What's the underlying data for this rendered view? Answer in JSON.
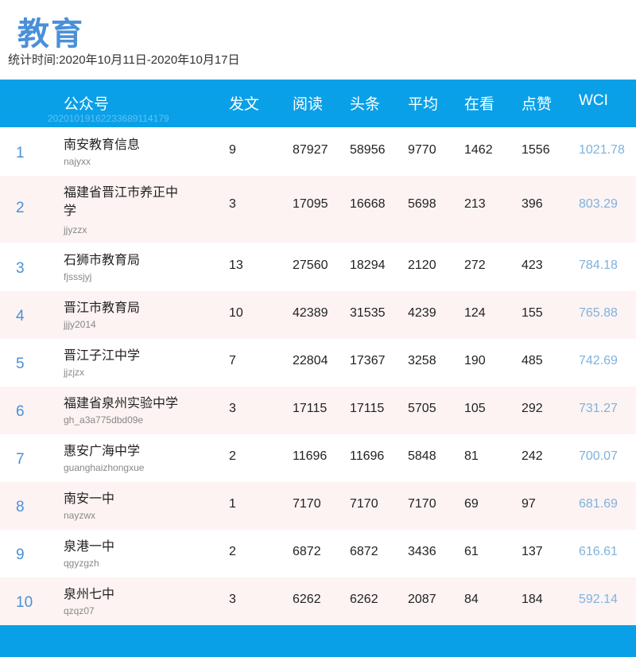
{
  "title": "教育",
  "period": "统计时间:2020年10月11日-2020年10月17日",
  "header": {
    "account": "公众号",
    "code": "20201019162233689114179",
    "posts": "发文",
    "reads": "阅读",
    "headline": "头条",
    "avg": "平均",
    "watching": "在看",
    "likes": "点赞",
    "wci": "WCI"
  },
  "rows": [
    {
      "rank": "1",
      "name": "南安教育信息",
      "acct": "najyxx",
      "posts": "9",
      "reads": "87927",
      "headline": "58956",
      "avg": "9770",
      "watching": "1462",
      "likes": "1556",
      "wci": "1021.78"
    },
    {
      "rank": "2",
      "name": "福建省晋江市养正中学",
      "acct": "jjyzzx",
      "posts": "3",
      "reads": "17095",
      "headline": "16668",
      "avg": "5698",
      "watching": "213",
      "likes": "396",
      "wci": "803.29"
    },
    {
      "rank": "3",
      "name": "石狮市教育局",
      "acct": "fjsssjyj",
      "posts": "13",
      "reads": "27560",
      "headline": "18294",
      "avg": "2120",
      "watching": "272",
      "likes": "423",
      "wci": "784.18"
    },
    {
      "rank": "4",
      "name": "晋江市教育局",
      "acct": "jjjy2014",
      "posts": "10",
      "reads": "42389",
      "headline": "31535",
      "avg": "4239",
      "watching": "124",
      "likes": "155",
      "wci": "765.88"
    },
    {
      "rank": "5",
      "name": "晋江子江中学",
      "acct": "jjzjzx",
      "posts": "7",
      "reads": "22804",
      "headline": "17367",
      "avg": "3258",
      "watching": "190",
      "likes": "485",
      "wci": "742.69"
    },
    {
      "rank": "6",
      "name": "福建省泉州实验中学",
      "acct": "gh_a3a775dbd09e",
      "posts": "3",
      "reads": "17115",
      "headline": "17115",
      "avg": "5705",
      "watching": "105",
      "likes": "292",
      "wci": "731.27"
    },
    {
      "rank": "7",
      "name": "惠安广海中学",
      "acct": "guanghaizhongxue",
      "posts": "2",
      "reads": "11696",
      "headline": "11696",
      "avg": "5848",
      "watching": "81",
      "likes": "242",
      "wci": "700.07"
    },
    {
      "rank": "8",
      "name": "南安一中",
      "acct": "nayzwx",
      "posts": "1",
      "reads": "7170",
      "headline": "7170",
      "avg": "7170",
      "watching": "69",
      "likes": "97",
      "wci": "681.69"
    },
    {
      "rank": "9",
      "name": "泉港一中",
      "acct": "qgyzgzh",
      "posts": "2",
      "reads": "6872",
      "headline": "6872",
      "avg": "3436",
      "watching": "61",
      "likes": "137",
      "wci": "616.61"
    },
    {
      "rank": "10",
      "name": "泉州七中",
      "acct": "qzqz07",
      "posts": "3",
      "reads": "6262",
      "headline": "6262",
      "avg": "2087",
      "watching": "84",
      "likes": "184",
      "wci": "592.14"
    }
  ],
  "colors": {
    "header": "#0aa0e8",
    "title": "#4a90d9",
    "wci": "#7fb2dd",
    "alt_row": "#fdf3f3"
  }
}
